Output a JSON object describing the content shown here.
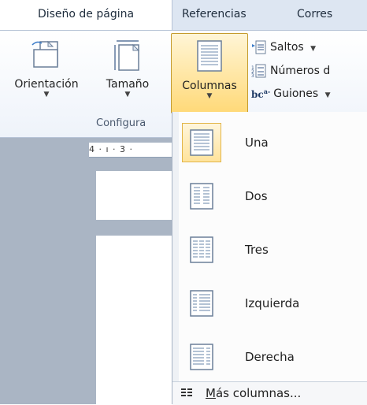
{
  "tabs": {
    "active": "Diseño de página",
    "references": "Referencias",
    "correspondence": "Corres"
  },
  "ribbon": {
    "orientation": "Orientación",
    "size": "Tamaño",
    "columns": "Columnas",
    "breaks": "Saltos",
    "line_numbers": "Números d",
    "hyphenation": "Guiones",
    "group_label": "Configura"
  },
  "ruler": {
    "text": "4 · ı · 3 ·"
  },
  "menu": {
    "items": [
      {
        "label": "Una",
        "icon": "one-column-icon",
        "selected": true
      },
      {
        "label": "Dos",
        "icon": "two-columns-icon",
        "selected": false
      },
      {
        "label": "Tres",
        "icon": "three-columns-icon",
        "selected": false
      },
      {
        "label": "Izquierda",
        "icon": "left-column-icon",
        "selected": false
      },
      {
        "label": "Derecha",
        "icon": "right-column-icon",
        "selected": false
      }
    ],
    "more_underlined": "M",
    "more_rest": "ás columnas..."
  },
  "colors": {
    "accent_selected": "#ffd978",
    "tab_background": "#dde6f2",
    "document_background": "#aab5c4"
  }
}
